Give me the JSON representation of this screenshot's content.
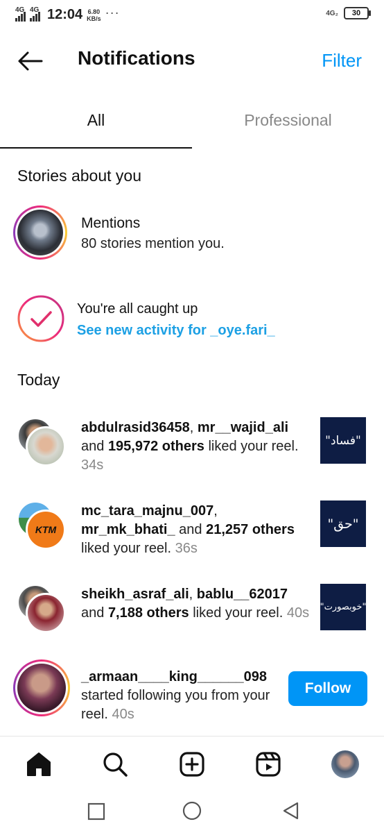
{
  "status_bar": {
    "signal1": "4G",
    "signal2": "4G",
    "time": "12:04",
    "speed_value": "6.80",
    "speed_unit": "KB/s",
    "more": "···",
    "network": "4G₂",
    "battery": "30"
  },
  "header": {
    "title": "Notifications",
    "filter_label": "Filter"
  },
  "tabs": [
    {
      "label": "All"
    },
    {
      "label": "Professional"
    }
  ],
  "stories_section": {
    "heading": "Stories about you",
    "mentions": {
      "title": "Mentions",
      "subtitle": "80 stories mention you."
    }
  },
  "caught_up": {
    "title": "You're all caught up",
    "link": "See new activity for _oye.fari_"
  },
  "today_section": {
    "heading": "Today",
    "items": [
      {
        "user1": "abdulrasid36458",
        "sep": ", ",
        "user2": "mr__wajid_ali",
        "pre": "and ",
        "others": "195,972 others",
        "action": " liked your reel. ",
        "time": "34s",
        "thumb_text": "\"فساد\""
      },
      {
        "user1": "mc_tara_majnu_007",
        "sep": ",",
        "user2": "mr_mk_bhati_",
        "pre": " and ",
        "others": "21,257 others",
        "action": " liked your reel. ",
        "time": "36s",
        "thumb_text": "\"حق\""
      },
      {
        "user1": "sheikh_asraf_ali",
        "sep": ", ",
        "user2": "bablu__62017",
        "pre": " and ",
        "others": "7,188 others",
        "action": " liked your reel. ",
        "time": "40s",
        "thumb_text": "\"خوبصورت\""
      }
    ],
    "follow_item": {
      "user": "_armaan____king______098",
      "action": "started following you from your reel. ",
      "time": "40s",
      "button": "Follow"
    }
  },
  "bottom_nav": [
    "home-icon",
    "search-icon",
    "create-icon",
    "reels-icon",
    "profile-avatar"
  ],
  "colors": {
    "accent": "#0095f6",
    "link": "#1ca0e4",
    "thumb_bg": "#0e1d44"
  }
}
